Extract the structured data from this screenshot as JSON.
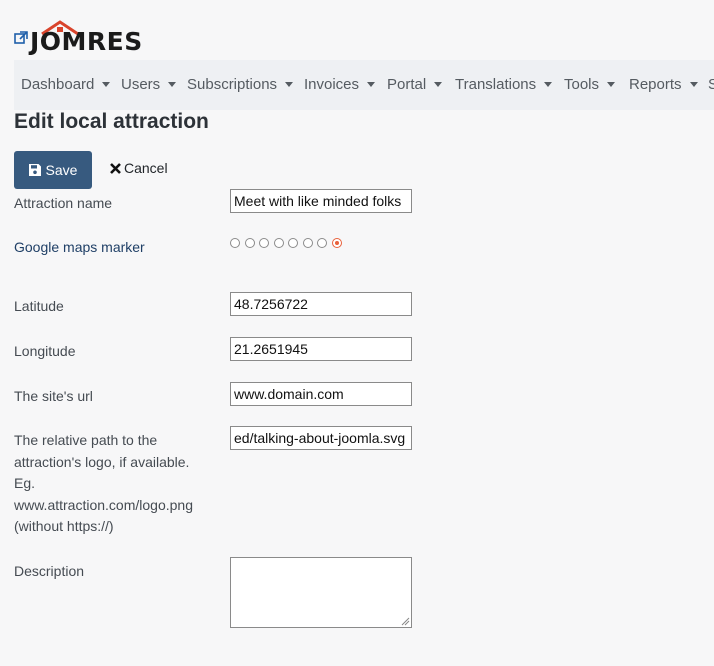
{
  "brand": {
    "logo_text": "JOMRES"
  },
  "nav": {
    "items": [
      {
        "label": "Dashboard",
        "key": "dashboard"
      },
      {
        "label": "Users",
        "key": "users"
      },
      {
        "label": "Subscriptions",
        "key": "subscriptions"
      },
      {
        "label": "Invoices",
        "key": "invoices"
      },
      {
        "label": "Portal",
        "key": "portal"
      },
      {
        "label": "Translations",
        "key": "translations"
      },
      {
        "label": "Tools",
        "key": "tools"
      },
      {
        "label": "Reports",
        "key": "reports"
      },
      {
        "label": "S",
        "key": "overflow"
      }
    ]
  },
  "page": {
    "title": "Edit local attraction"
  },
  "toolbar": {
    "save_label": "Save",
    "cancel_label": "Cancel"
  },
  "form": {
    "attraction_name": {
      "label": "Attraction name",
      "value": "Meet with like minded folks"
    },
    "google_maps_marker": {
      "label": "Google maps marker",
      "options_count": 8,
      "selected_index": 7
    },
    "latitude": {
      "label": "Latitude",
      "value": "48.7256722"
    },
    "longitude": {
      "label": "Longitude",
      "value": "21.2651945"
    },
    "site_url": {
      "label": "The site's url",
      "value": "www.domain.com"
    },
    "logo_path": {
      "label": "The relative path to the attraction's logo, if available. Eg. www.attraction.com/logo.png (without https://)",
      "value": "ed/talking-about-joomla.svg"
    },
    "description": {
      "label": "Description",
      "value": ""
    }
  },
  "colors": {
    "primary": "#375a7f",
    "accent_radio": "#e8613c",
    "logo_roof": "#d9442c",
    "link": "#1f3f66"
  }
}
